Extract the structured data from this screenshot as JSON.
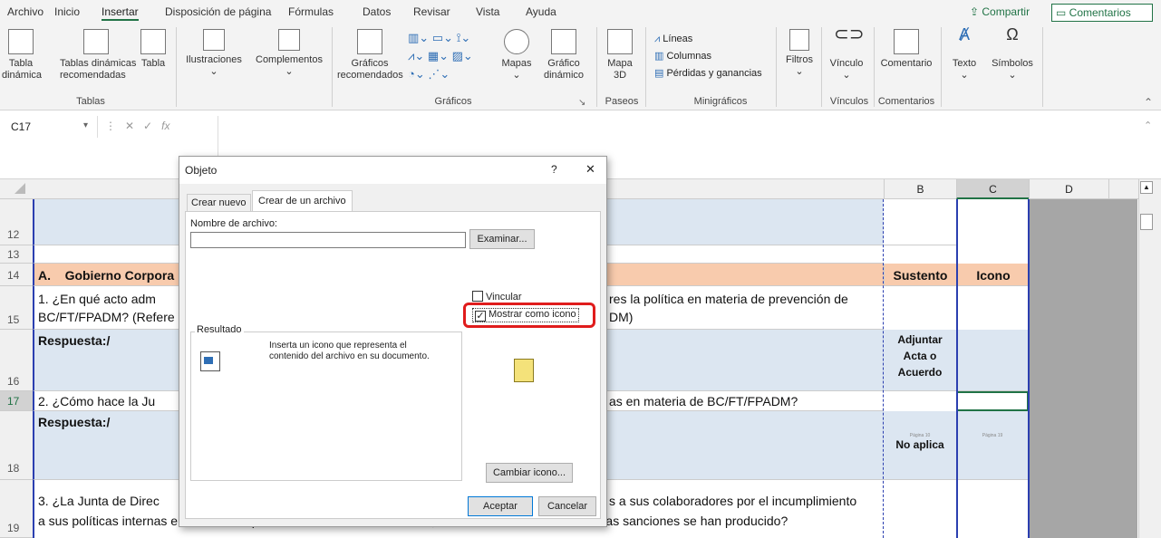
{
  "tabs": [
    "Archivo",
    "Inicio",
    "Insertar",
    "Disposición de página",
    "Fórmulas",
    "Datos",
    "Revisar",
    "Vista",
    "Ayuda"
  ],
  "share_label": "Compartir",
  "comments_label": "Comentarios",
  "ribbon": {
    "tabla_dinamica": "Tabla\ndinámica",
    "tablas_recomendadas": "Tablas dinámicas\nrecomendadas",
    "tabla": "Tabla",
    "ilustraciones": "Ilustraciones",
    "complementos": "Complementos",
    "graficos_recomendados": "Gráficos\nrecomendados",
    "mapas": "Mapas",
    "grafico_dinamico": "Gráfico\ndinámico",
    "mapa3d": "Mapa\n3D",
    "lineas": "Líneas",
    "columnas": "Columnas",
    "perdidas": "Pérdidas y ganancias",
    "filtros": "Filtros",
    "vinculo": "Vínculo",
    "comentario": "Comentario",
    "texto": "Texto",
    "simbolos": "Símbolos",
    "groups": {
      "tablas": "Tablas",
      "graficos": "Gráficos",
      "paseos": "Paseos",
      "minigraficos": "Minigráficos",
      "vinculos": "Vínculos",
      "comentarios": "Comentarios"
    }
  },
  "namebox": "C17",
  "fx": "fx",
  "columns": [
    "B",
    "C",
    "D"
  ],
  "rows": {
    "r12": "12",
    "r13": "13",
    "r14": "14",
    "r15": "15",
    "r16": "16",
    "r17": "17",
    "r18": "18",
    "r19": "19"
  },
  "sheet": {
    "a14_num": "A.",
    "a14": "Gobierno Corpora",
    "a14_rest": "",
    "b14": "Sustento",
    "c14": "Icono",
    "a15_l1": "1.     ¿En qué acto adm",
    "a15_l2": "BC/FT/FPADM? (Refere",
    "a15_r1": "res la política en materia de prevención de",
    "a15_r2": "DM)",
    "a16": "Respuesta:/",
    "b16": "Adjuntar\nActa o\nAcuerdo",
    "a17": "2.     ¿Cómo hace la Ju",
    "a17_r": "as en materia de BC/FT/FPADM?",
    "a18": "Respuesta:/",
    "b18_small": "Página 10",
    "c18_small": "Página 19",
    "b18": "No aplica",
    "a19_l1": "3.     ¿La Junta de Direc",
    "a19_r1": "s a sus colaboradores por el incumplimiento",
    "a19_l2": "a sus políticas internas en materia de prevención de BC/FT/FPADM? ¿Tienen conocimiento de cuántas sanciones se han producido?"
  },
  "dialog": {
    "title": "Objeto",
    "help": "?",
    "close": "✕",
    "tab_new": "Crear nuevo",
    "tab_file": "Crear de un archivo",
    "filename_label": "Nombre de archivo:",
    "filename_value": "",
    "browse": "Examinar...",
    "link": "Vincular",
    "show_icon": "Mostrar como icono",
    "result_label": "Resultado",
    "result_text": "Inserta un icono que representa el contenido del archivo en su documento.",
    "change_icon": "Cambiar icono...",
    "ok": "Aceptar",
    "cancel": "Cancelar"
  }
}
